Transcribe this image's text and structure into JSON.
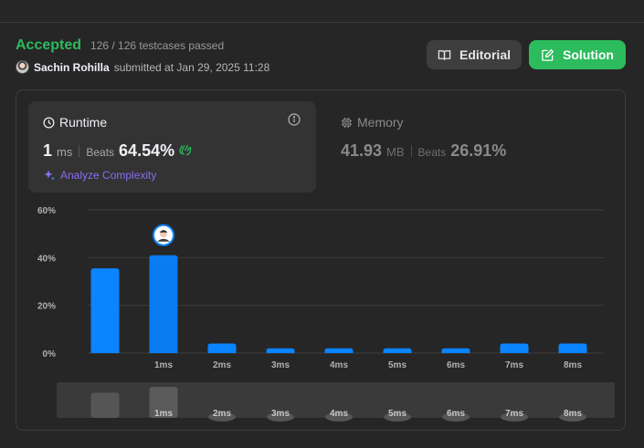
{
  "result": {
    "status": "Accepted",
    "testcases": "126 / 126 testcases passed",
    "username": "Sachin Rohilla",
    "submitted_at": "submitted at Jan 29, 2025 11:28"
  },
  "actions": {
    "editorial_label": "Editorial",
    "solution_label": "Solution"
  },
  "runtime": {
    "title": "Runtime",
    "value": "1",
    "unit": "ms",
    "beats_label": "Beats",
    "beats_pct": "64.54%",
    "analyze_label": "Analyze Complexity"
  },
  "memory": {
    "title": "Memory",
    "value": "41.93",
    "unit": "MB",
    "beats_label": "Beats",
    "beats_pct": "26.91%"
  },
  "colors": {
    "accepted": "#2cbb5d",
    "bar": "#0a84ff",
    "bar_active": "#0a7bf0",
    "analyze": "#8b6cf0"
  },
  "chart_data": {
    "type": "bar",
    "categories": [
      "",
      "1ms",
      "2ms",
      "3ms",
      "4ms",
      "5ms",
      "6ms",
      "7ms",
      "8ms"
    ],
    "values": [
      35.5,
      41,
      4,
      2,
      2,
      2,
      2,
      4,
      4
    ],
    "ylim": [
      0,
      60
    ],
    "y_ticks": [
      "0%",
      "20%",
      "40%",
      "60%"
    ],
    "highlighted_category": "1ms",
    "grid": true,
    "mini_values": [
      13,
      16,
      2,
      1,
      1,
      1,
      1,
      2,
      2
    ]
  }
}
